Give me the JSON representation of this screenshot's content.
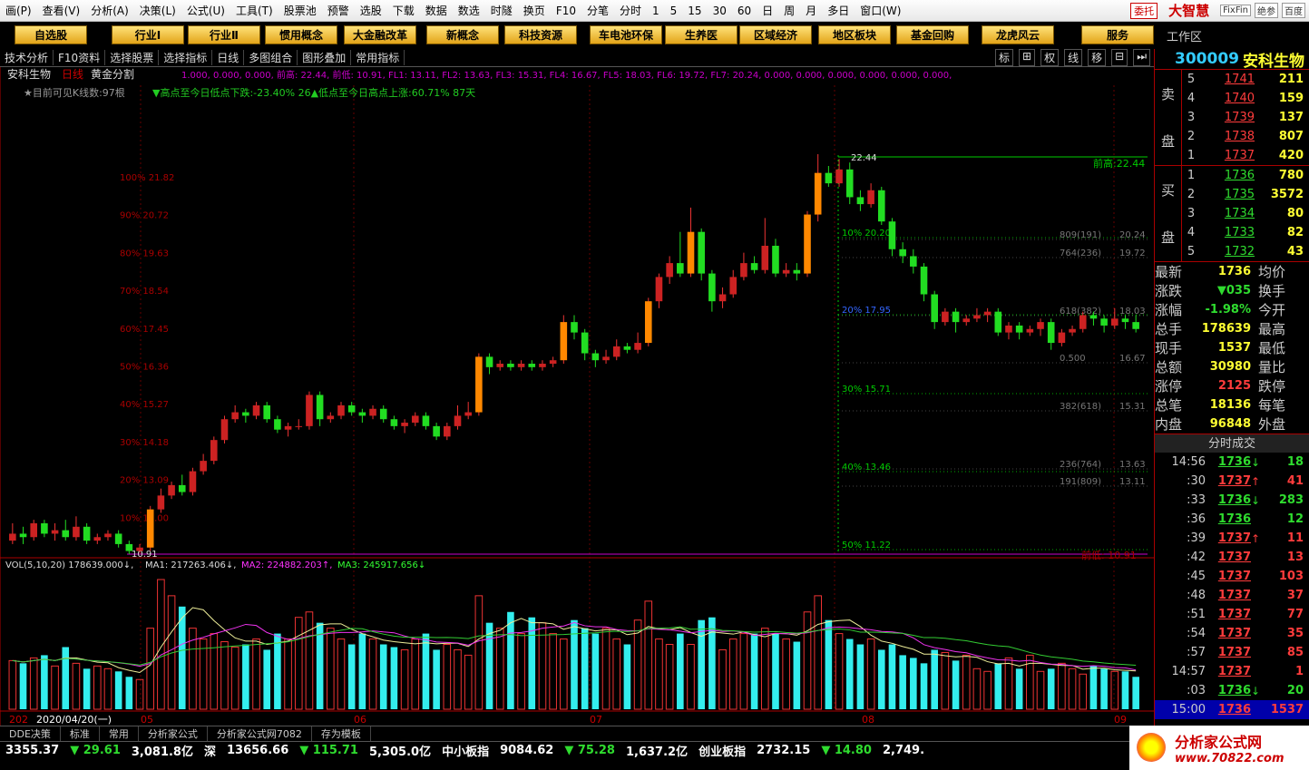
{
  "menu": [
    "画(P)",
    "查看(V)",
    "分析(A)",
    "决策(L)",
    "公式(U)",
    "工具(T)",
    "股票池",
    "预警",
    "选股",
    "下载",
    "数据",
    "数选",
    "时隧",
    "换页",
    "F10",
    "分笔",
    "分时",
    "1",
    "5",
    "15",
    "30",
    "60",
    "日",
    "周",
    "月",
    "多日",
    "窗口(W)"
  ],
  "menu_right": {
    "entrust": "委托",
    "logo": "大智慧",
    "btn1": "FixFin",
    "btn2": "绝参",
    "btn3": "百度"
  },
  "toolbar": [
    "自选股",
    "行业Ⅰ",
    "行业Ⅱ",
    "惯用概念",
    "大金融改革",
    "新概念",
    "科技资源",
    "车电池环保",
    "生养医",
    "区域经济",
    "地区板块",
    "基金回购",
    "龙虎风云",
    "服务"
  ],
  "workarea": "工作区",
  "subbar": [
    "技术分析",
    "F10资料",
    "选择股票",
    "选择指标",
    "日线",
    "多图组合",
    "图形叠加",
    "常用指标"
  ],
  "subbar_icons": [
    "标",
    "⊞",
    "权",
    "线",
    "移",
    "⊟",
    "⏭"
  ],
  "chart": {
    "title_stock": "安科生物",
    "title_period": "日线",
    "title_overlay": "黄金分割",
    "info_line": "★目前可见K线数:97根",
    "stats_line": "▼高点至今日低点下跌:-23.40%  26▲低点至今日高点上涨:60.71%  87天",
    "formula_line": "1.000, 0.000, 0.000,  前高: 22.44, 前低: 10.91, FL1: 13.11, FL2: 13.63, FL3: 15.31, FL4: 16.67, FL5: 18.03, FL6: 19.72, FL7: 20.24, 0.000, 0.000, 0.000, 0.000, 0.000, 0.000,",
    "vol_line": {
      "label": "VOL(5,10,20)",
      "vol": "178639.000↓",
      "ma1": "MA1: 217263.406↓",
      "ma2": "MA2: 224882.203↑",
      "ma3": "MA3: 245917.656↓"
    },
    "left_levels": [
      {
        "pct": "100%",
        "val": "21.82"
      },
      {
        "pct": "90%",
        "val": "20.72"
      },
      {
        "pct": "80%",
        "val": "19.63"
      },
      {
        "pct": "70%",
        "val": "18.54"
      },
      {
        "pct": "60%",
        "val": "17.45"
      },
      {
        "pct": "50%",
        "val": "16.36"
      },
      {
        "pct": "40%",
        "val": "15.27"
      },
      {
        "pct": "30%",
        "val": "14.18"
      },
      {
        "pct": "20%",
        "val": "13.09"
      },
      {
        "pct": "10%",
        "val": "12.00"
      }
    ],
    "right_pct_levels": [
      {
        "pct": "10%",
        "val": "20.20"
      },
      {
        "pct": "20%",
        "val": "17.95"
      },
      {
        "pct": "30%",
        "val": "15.71"
      },
      {
        "pct": "40%",
        "val": "13.46"
      },
      {
        "pct": "50%",
        "val": "11.22"
      }
    ],
    "fib_levels": [
      {
        "label": "809(191)",
        "val": "20.24"
      },
      {
        "label": "764(236)",
        "val": "19.72"
      },
      {
        "label": "618(382)",
        "val": "18.03"
      },
      {
        "label": "0.500",
        "val": "16.67"
      },
      {
        "label": "382(618)",
        "val": "15.31"
      },
      {
        "label": "236(764)",
        "val": "13.63"
      },
      {
        "label": "191(809)",
        "val": "13.11"
      }
    ],
    "high_label": "22.44",
    "high_right": "前高:22.44",
    "low_label": "10.91",
    "low_right": "前低: 10.91",
    "months": [
      "202",
      "2020/04/20(一)",
      "05",
      "06",
      "07",
      "08",
      "09"
    ]
  },
  "chart_data": {
    "type": "candlestick",
    "y_range": [
      10.91,
      22.44
    ],
    "candles": [
      [
        11.3,
        11.5,
        11.2,
        11.8
      ],
      [
        11.5,
        11.4,
        11.2,
        11.7
      ],
      [
        11.4,
        11.8,
        11.3,
        11.9
      ],
      [
        11.8,
        11.5,
        11.4,
        11.9
      ],
      [
        11.5,
        11.6,
        11.3,
        11.8
      ],
      [
        11.6,
        11.4,
        11.3,
        11.9
      ],
      [
        11.4,
        11.7,
        11.3,
        12.0
      ],
      [
        11.7,
        11.3,
        11.2,
        11.8
      ],
      [
        11.3,
        11.4,
        11.2,
        11.5
      ],
      [
        11.4,
        11.5,
        11.3,
        11.6
      ],
      [
        11.5,
        11.2,
        11.1,
        11.6
      ],
      [
        11.2,
        11.0,
        10.91,
        11.3
      ],
      [
        11.0,
        11.1,
        10.95,
        11.2
      ],
      [
        11.1,
        12.2,
        11.0,
        12.3
      ],
      [
        12.2,
        12.6,
        12.1,
        12.8
      ],
      [
        12.6,
        12.9,
        12.5,
        13.0
      ],
      [
        12.9,
        12.7,
        12.6,
        13.2
      ],
      [
        12.7,
        13.3,
        12.6,
        13.4
      ],
      [
        13.3,
        13.6,
        13.2,
        13.8
      ],
      [
        13.6,
        14.2,
        13.5,
        14.3
      ],
      [
        14.2,
        14.8,
        14.1,
        14.9
      ],
      [
        14.8,
        15.0,
        14.7,
        15.2
      ],
      [
        15.0,
        14.9,
        14.7,
        15.1
      ],
      [
        14.9,
        15.2,
        14.8,
        15.3
      ],
      [
        15.2,
        14.8,
        14.7,
        15.3
      ],
      [
        14.8,
        14.5,
        14.4,
        14.9
      ],
      [
        14.5,
        14.6,
        14.3,
        14.7
      ],
      [
        14.6,
        14.6,
        14.5,
        14.8
      ],
      [
        14.6,
        15.5,
        14.5,
        15.6
      ],
      [
        15.5,
        14.8,
        14.6,
        15.6
      ],
      [
        14.8,
        14.9,
        14.7,
        15.0
      ],
      [
        14.9,
        15.2,
        14.8,
        15.3
      ],
      [
        15.2,
        15.0,
        14.9,
        15.3
      ],
      [
        15.0,
        14.9,
        14.7,
        15.1
      ],
      [
        14.9,
        15.1,
        14.8,
        15.2
      ],
      [
        15.1,
        14.8,
        14.7,
        15.2
      ],
      [
        14.8,
        14.6,
        14.5,
        14.9
      ],
      [
        14.6,
        14.7,
        14.4,
        14.8
      ],
      [
        14.7,
        14.9,
        14.6,
        15.0
      ],
      [
        14.9,
        14.6,
        14.5,
        15.0
      ],
      [
        14.6,
        14.3,
        14.2,
        14.7
      ],
      [
        14.3,
        14.6,
        14.2,
        14.7
      ],
      [
        14.6,
        14.9,
        14.5,
        15.2
      ],
      [
        14.9,
        15.0,
        14.8,
        15.3
      ],
      [
        15.0,
        16.6,
        14.9,
        16.7
      ],
      [
        16.6,
        16.3,
        16.1,
        16.7
      ],
      [
        16.3,
        16.4,
        16.2,
        16.5
      ],
      [
        16.4,
        16.3,
        16.2,
        16.5
      ],
      [
        16.3,
        16.4,
        16.2,
        16.5
      ],
      [
        16.4,
        16.3,
        16.2,
        16.5
      ],
      [
        16.3,
        16.4,
        16.2,
        16.5
      ],
      [
        16.4,
        16.5,
        16.3,
        16.6
      ],
      [
        16.5,
        17.6,
        16.4,
        17.8
      ],
      [
        17.6,
        17.3,
        17.1,
        17.8
      ],
      [
        17.3,
        16.7,
        16.5,
        17.4
      ],
      [
        16.7,
        16.5,
        16.3,
        16.8
      ],
      [
        16.5,
        16.6,
        16.4,
        16.8
      ],
      [
        16.6,
        16.9,
        16.5,
        17.1
      ],
      [
        16.9,
        16.8,
        16.7,
        17.0
      ],
      [
        16.8,
        17.0,
        16.7,
        17.3
      ],
      [
        17.0,
        18.2,
        16.9,
        18.3
      ],
      [
        18.2,
        18.9,
        18.0,
        19.0
      ],
      [
        18.9,
        19.3,
        18.7,
        19.5
      ],
      [
        19.3,
        19.0,
        18.9,
        20.2
      ],
      [
        19.0,
        20.2,
        18.9,
        20.9
      ],
      [
        20.2,
        19.0,
        18.8,
        20.3
      ],
      [
        19.0,
        18.2,
        17.9,
        19.1
      ],
      [
        18.2,
        18.4,
        18.0,
        18.6
      ],
      [
        18.4,
        18.9,
        18.3,
        19.1
      ],
      [
        18.9,
        19.3,
        18.8,
        19.6
      ],
      [
        19.3,
        19.1,
        19.0,
        19.5
      ],
      [
        19.1,
        19.8,
        19.0,
        20.6
      ],
      [
        19.8,
        19.0,
        18.9,
        20.0
      ],
      [
        19.0,
        19.1,
        18.9,
        19.3
      ],
      [
        19.1,
        19.0,
        18.8,
        19.3
      ],
      [
        19.0,
        20.7,
        18.9,
        20.8
      ],
      [
        20.7,
        21.9,
        20.5,
        22.44
      ],
      [
        21.9,
        21.6,
        21.5,
        22.1
      ],
      [
        21.6,
        22.0,
        21.5,
        22.3
      ],
      [
        22.0,
        21.2,
        21.0,
        22.2
      ],
      [
        21.2,
        21.0,
        20.8,
        21.4
      ],
      [
        21.0,
        21.4,
        20.9,
        21.6
      ],
      [
        21.4,
        20.5,
        20.4,
        21.5
      ],
      [
        20.5,
        19.7,
        19.5,
        20.6
      ],
      [
        19.7,
        19.5,
        19.3,
        19.9
      ],
      [
        19.5,
        19.2,
        19.0,
        19.7
      ],
      [
        19.2,
        18.4,
        18.2,
        19.3
      ],
      [
        18.4,
        17.6,
        17.4,
        18.5
      ],
      [
        17.6,
        17.9,
        17.5,
        18.0
      ],
      [
        17.9,
        17.6,
        17.3,
        18.0
      ],
      [
        17.6,
        17.7,
        17.5,
        17.8
      ],
      [
        17.7,
        17.8,
        17.6,
        18.0
      ],
      [
        17.8,
        17.9,
        17.6,
        18.0
      ],
      [
        17.9,
        17.3,
        17.2,
        18.0
      ],
      [
        17.3,
        17.5,
        17.1,
        17.6
      ],
      [
        17.5,
        17.3,
        17.1,
        17.6
      ],
      [
        17.3,
        17.4,
        17.2,
        17.5
      ],
      [
        17.4,
        17.6,
        17.2,
        17.7
      ],
      [
        17.6,
        17.0,
        16.8,
        17.7
      ],
      [
        17.0,
        17.3,
        16.9,
        17.4
      ],
      [
        17.3,
        17.4,
        17.2,
        17.5
      ],
      [
        17.4,
        17.8,
        17.3,
        17.9
      ],
      [
        17.8,
        17.7,
        17.5,
        17.9
      ],
      [
        17.7,
        17.5,
        17.3,
        17.8
      ],
      [
        17.5,
        17.7,
        17.4,
        18.0
      ],
      [
        17.7,
        17.6,
        17.4,
        17.8
      ],
      [
        17.6,
        17.4,
        17.3,
        17.8
      ]
    ],
    "volumes": [
      180,
      170,
      190,
      200,
      160,
      230,
      170,
      150,
      160,
      150,
      140,
      120,
      110,
      300,
      480,
      420,
      380,
      300,
      260,
      280,
      250,
      230,
      240,
      260,
      220,
      280,
      260,
      340,
      360,
      320,
      300,
      260,
      240,
      280,
      260,
      240,
      230,
      220,
      260,
      280,
      220,
      240,
      220,
      200,
      420,
      320,
      300,
      360,
      280,
      340,
      320,
      280,
      260,
      330,
      300,
      280,
      300,
      260,
      240,
      330,
      400,
      260,
      240,
      280,
      240,
      330,
      340,
      220,
      260,
      280,
      280,
      300,
      280,
      260,
      250,
      360,
      420,
      330,
      280,
      260,
      240,
      260,
      220,
      240,
      200,
      190,
      170,
      220,
      210,
      180,
      200,
      150,
      140,
      170,
      190,
      150,
      200,
      140,
      150,
      170,
      150,
      130,
      160,
      150,
      140,
      140,
      120
    ],
    "ma_lines": [
      "MA1",
      "MA2",
      "MA3"
    ]
  },
  "orderbook": {
    "code": "300009",
    "name": "安科生物",
    "sell_label": [
      "卖",
      "盘"
    ],
    "buy_label": [
      "买",
      "盘"
    ],
    "sell": [
      {
        "lv": "5",
        "p": "1741",
        "v": "211"
      },
      {
        "lv": "4",
        "p": "1740",
        "v": "159"
      },
      {
        "lv": "3",
        "p": "1739",
        "v": "137"
      },
      {
        "lv": "2",
        "p": "1738",
        "v": "807"
      },
      {
        "lv": "1",
        "p": "1737",
        "v": "420"
      }
    ],
    "buy": [
      {
        "lv": "1",
        "p": "1736",
        "v": "780"
      },
      {
        "lv": "2",
        "p": "1735",
        "v": "3572"
      },
      {
        "lv": "3",
        "p": "1734",
        "v": "80"
      },
      {
        "lv": "4",
        "p": "1733",
        "v": "82"
      },
      {
        "lv": "5",
        "p": "1732",
        "v": "43"
      }
    ]
  },
  "stats": [
    {
      "l": "最新",
      "v": "1736",
      "c": "yl",
      "l2": "均价"
    },
    {
      "l": "涨跌",
      "v": "▼035",
      "c": "dn",
      "l2": "换手"
    },
    {
      "l": "涨幅",
      "v": "-1.98%",
      "c": "dn",
      "l2": "今开"
    },
    {
      "l": "总手",
      "v": "178639",
      "c": "yl",
      "l2": "最高"
    },
    {
      "l": "现手",
      "v": "1537",
      "c": "yl",
      "l2": "最低"
    },
    {
      "l": "总额",
      "v": "30980",
      "c": "yl",
      "l2": "量比"
    },
    {
      "l": "涨停",
      "v": "2125",
      "c": "up",
      "l2": "跌停"
    },
    {
      "l": "总笔",
      "v": "18136",
      "c": "yl",
      "l2": "每笔"
    },
    {
      "l": "内盘",
      "v": "96848",
      "c": "yl",
      "l2": "外盘"
    }
  ],
  "ticks_title": "分时成交",
  "ticks": [
    {
      "t": "14:56",
      "p": "1736",
      "a": "↓",
      "v": "18",
      "c": "dn"
    },
    {
      "t": ":30",
      "p": "1737",
      "a": "↑",
      "v": "41",
      "c": "up"
    },
    {
      "t": ":33",
      "p": "1736",
      "a": "↓",
      "v": "283",
      "c": "dn"
    },
    {
      "t": ":36",
      "p": "1736",
      "a": "",
      "v": "12",
      "c": "dn"
    },
    {
      "t": ":39",
      "p": "1737",
      "a": "↑",
      "v": "11",
      "c": "up"
    },
    {
      "t": ":42",
      "p": "1737",
      "a": "",
      "v": "13",
      "c": "up"
    },
    {
      "t": ":45",
      "p": "1737",
      "a": "",
      "v": "103",
      "c": "up"
    },
    {
      "t": ":48",
      "p": "1737",
      "a": "",
      "v": "37",
      "c": "up"
    },
    {
      "t": ":51",
      "p": "1737",
      "a": "",
      "v": "77",
      "c": "up"
    },
    {
      "t": ":54",
      "p": "1737",
      "a": "",
      "v": "35",
      "c": "up"
    },
    {
      "t": ":57",
      "p": "1737",
      "a": "",
      "v": "85",
      "c": "up"
    },
    {
      "t": "14:57",
      "p": "1737",
      "a": "",
      "v": "1",
      "c": "up"
    },
    {
      "t": ":03",
      "p": "1736",
      "a": "↓",
      "v": "20",
      "c": "dn"
    },
    {
      "t": "15:00",
      "p": "1736",
      "a": "",
      "v": "1537",
      "c": "up"
    }
  ],
  "bottom_tabs": [
    "DDE决策",
    "标准",
    "常用",
    "分析家公式",
    "分析家公式网7082",
    "存为模板"
  ],
  "ticker": [
    {
      "v": "3355.37",
      "c": "wh"
    },
    {
      "v": "▼ 29.61",
      "c": "dn"
    },
    {
      "v": "3,081.8亿",
      "c": "wh"
    },
    {
      "v": "深",
      "c": "wh"
    },
    {
      "v": "13656.66",
      "c": "wh"
    },
    {
      "v": "▼ 115.71",
      "c": "dn"
    },
    {
      "v": "5,305.0亿",
      "c": "wh"
    },
    {
      "v": "中小板指",
      "c": "wh"
    },
    {
      "v": "9084.62",
      "c": "wh"
    },
    {
      "v": "▼ 75.28",
      "c": "dn"
    },
    {
      "v": "1,637.2亿",
      "c": "wh"
    },
    {
      "v": "创业板指",
      "c": "wh"
    },
    {
      "v": "2732.15",
      "c": "wh"
    },
    {
      "v": "▼ 14.80",
      "c": "dn"
    },
    {
      "v": "2,749.",
      "c": "wh"
    }
  ],
  "brand": {
    "line1": "分析家公式网",
    "line2": "www.70822.com"
  }
}
